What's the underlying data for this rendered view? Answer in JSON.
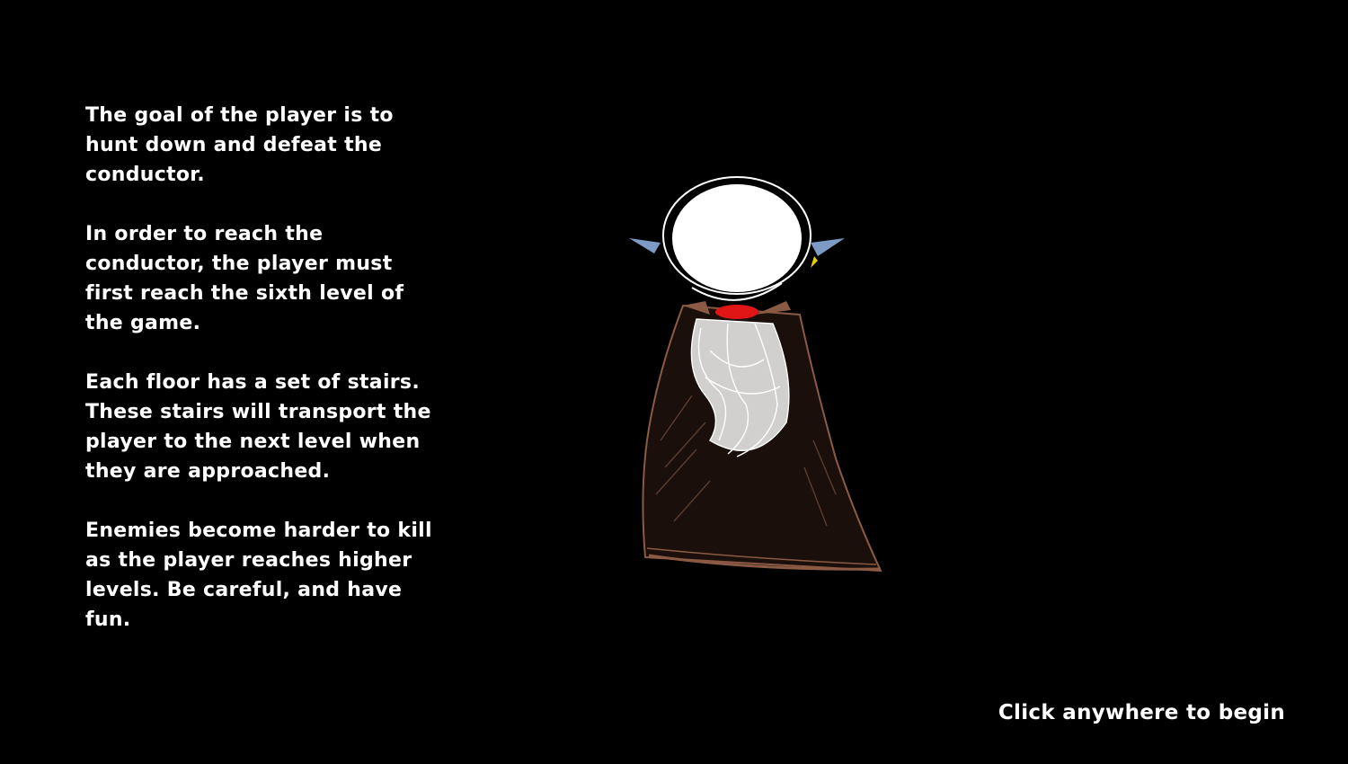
{
  "instructions": {
    "paragraphs": [
      "The goal of the player is to hunt down and defeat the conductor.",
      "In order to reach the conductor, the player must first reach the sixth level of the game.",
      "Each floor has a set of stairs. These stairs will transport the player to the next level when they are approached.",
      "Enemies become harder to kill as the player reaches higher levels.  Be careful, and have fun."
    ]
  },
  "prompt": {
    "begin": "Click anywhere to begin"
  },
  "character": {
    "icon": "conductor-sketch",
    "colors": {
      "head": "#ffffff",
      "ears": "#7d9ac4",
      "collar": "#e01515",
      "cloak": "#8a5a44",
      "beard": "#ffffff",
      "accent": "#e8d000"
    }
  }
}
